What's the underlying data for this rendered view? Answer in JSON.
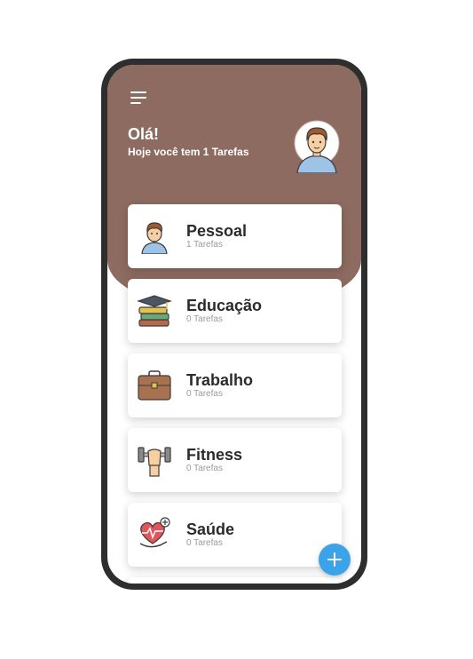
{
  "header": {
    "greeting": "Olá!",
    "subtitle": "Hoje você tem 1 Tarefas"
  },
  "colors": {
    "header_bg": "#8d6b60",
    "fab": "#3da3e8",
    "phone_frame": "#2e2e2e"
  },
  "categories": [
    {
      "title": "Pessoal",
      "count": "1 Tarefas",
      "icon": "person-icon"
    },
    {
      "title": "Educação",
      "count": "0 Tarefas",
      "icon": "graduation-cap-books-icon"
    },
    {
      "title": "Trabalho",
      "count": "0 Tarefas",
      "icon": "briefcase-icon"
    },
    {
      "title": "Fitness",
      "count": "0 Tarefas",
      "icon": "dumbbell-icon"
    },
    {
      "title": "Saúde",
      "count": "0 Tarefas",
      "icon": "heart-health-icon"
    }
  ],
  "fab": {
    "icon": "plus-icon"
  }
}
